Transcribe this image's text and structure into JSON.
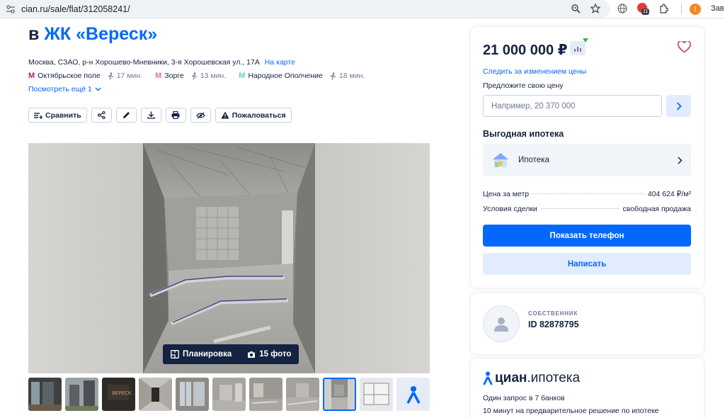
{
  "browser": {
    "url": "cian.ru/sale/flat/312058241/",
    "ext_badge": "11",
    "profile_initial": "I",
    "profile_label": "Зав"
  },
  "listing": {
    "title_prefix": "в",
    "title_link": "ЖК «Вереск»",
    "address": "Москва, СЗАО, р-н Хорошево-Мневники, 3-я Хорошевская ул., 17А",
    "map_link": "На карте",
    "metro": [
      {
        "name": "Октябрьское поле",
        "walk": "17 мин.",
        "color": "#b4206f"
      },
      {
        "name": "Зорге",
        "walk": "13 мин.",
        "color": "#f26d9c"
      },
      {
        "name": "Народное Ополчение",
        "walk": "18 мин.",
        "color": "#5fd2c6"
      }
    ],
    "more": "Посмотреть ещё 1",
    "toolbar": {
      "compare": "Сравнить",
      "complain": "Пожаловаться"
    },
    "gallery": {
      "layout_label": "Планировка",
      "photos_label": "15 фото"
    }
  },
  "price_card": {
    "price": "21 000 000 ₽",
    "follow": "Следить за изменением цены",
    "offer_label": "Предложите свою цену",
    "offer_placeholder": "Например, 20 370 000",
    "mortgage_heading": "Выгодная ипотека",
    "mortgage_label": "Ипотека",
    "rows": [
      {
        "key": "Цена за метр",
        "value": "404 624 ₽/м²"
      },
      {
        "key": "Условия сделки",
        "value": "свободная продажа"
      }
    ],
    "phone_button": "Показать телефон",
    "write_button": "Написать"
  },
  "owner": {
    "role": "СОБСТВЕННИК",
    "id": "ID 82878795"
  },
  "cian_promo": {
    "logo_bold": "циан",
    "logo_rest": ".ипотека",
    "line1": "Один запрос в 7 банков",
    "line2": "10 минут на предварительное решение по ипотеке"
  },
  "colors": {
    "brand": "#0468ff",
    "text": "#152242",
    "muted": "#707a95"
  }
}
